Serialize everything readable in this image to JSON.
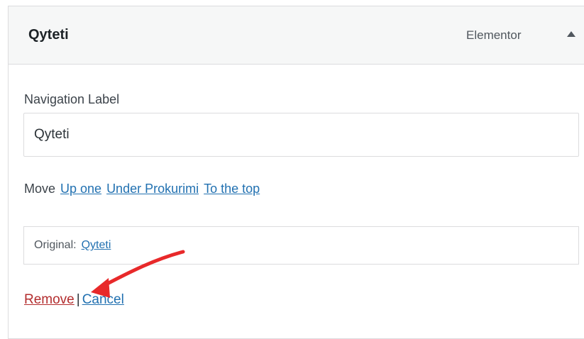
{
  "menu_item": {
    "title": "Qyteti",
    "type": "Elementor",
    "toggle_icon": "arrow-up-icon"
  },
  "navigation_label": {
    "label": "Navigation Label",
    "value": "Qyteti"
  },
  "move": {
    "label": "Move",
    "links": [
      "Up one",
      "Under Prokurimi",
      "To the top"
    ]
  },
  "original": {
    "label": "Original:",
    "link": "Qyteti"
  },
  "actions": {
    "remove": "Remove",
    "separator": "|",
    "cancel": "Cancel"
  },
  "colors": {
    "link": "#2271b1",
    "remove": "#b32d2e",
    "header_bg": "#f6f7f7",
    "annotation_arrow": "#e8292a"
  }
}
